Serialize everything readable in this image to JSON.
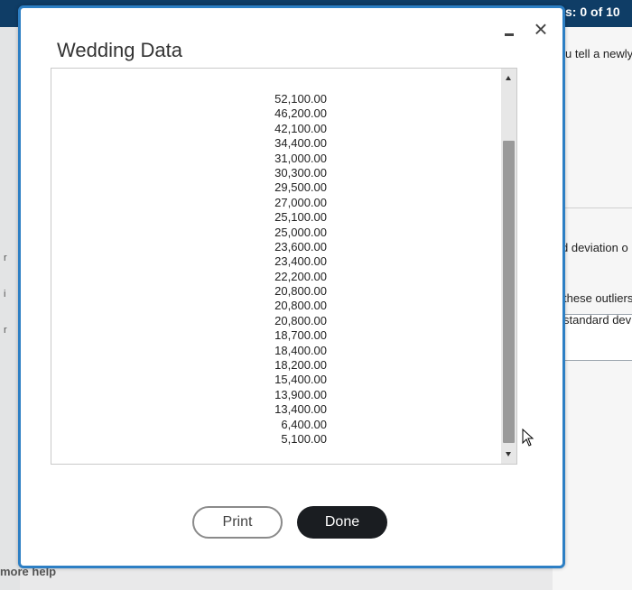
{
  "window": {
    "title": "Wedding Data"
  },
  "data_list": {
    "values": [
      "52,100.00",
      "46,200.00",
      "42,100.00",
      "34,400.00",
      "31,000.00",
      "30,300.00",
      "29,500.00",
      "27,000.00",
      "25,100.00",
      "25,000.00",
      "23,600.00",
      "23,400.00",
      "22,200.00",
      "20,800.00",
      "20,800.00",
      "20,800.00",
      "18,700.00",
      "18,400.00",
      "18,200.00",
      "15,400.00",
      "13,900.00",
      "13,400.00",
      "6,400.00",
      "5,100.00"
    ]
  },
  "buttons": {
    "print_label": "Print",
    "done_label": "Done"
  },
  "icons": {
    "minimize": "minimize-icon",
    "close": "close-icon",
    "close_glyph": "×"
  },
  "background": {
    "score_text": "s: 0 of 10",
    "snippet_1": "u tell a newly",
    "snippet_2": "d deviation o",
    "snippet_3": "these outliers",
    "snippet_4": "standard dev",
    "bottom_text": "more help"
  },
  "colors": {
    "dialog_border": "#2d7fc4",
    "done_button": "#1a1d21",
    "topbar": "#0f3d66"
  }
}
